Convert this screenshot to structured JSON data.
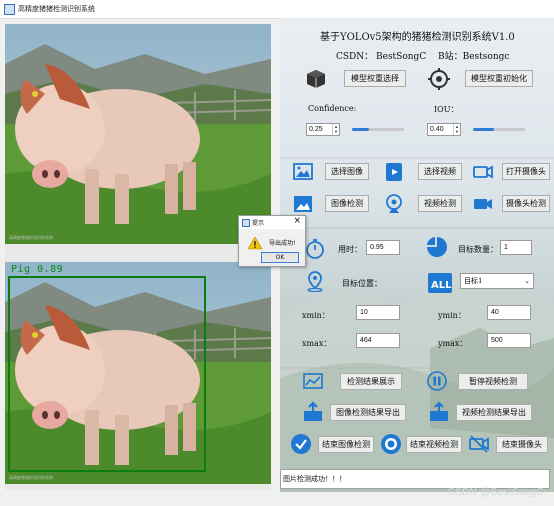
{
  "window": {
    "title": "高精度猪猪检测识别系统"
  },
  "header": {
    "title": "基于YOLOv5架构的猪猪检测识别系统V1.0",
    "csdn": "CSDN： BestSongC",
    "bili": "B站：Bestsongc"
  },
  "model": {
    "select_btn": "模型权重选择",
    "init_btn": "模型权重初始化"
  },
  "params": {
    "confidence_label": "Confidence:",
    "confidence_value": "0.25",
    "confidence_level": 0.25,
    "iou_label": "IOU：",
    "iou_value": "0.40",
    "iou_level": 0.4
  },
  "actions": {
    "select_image": "选择图像",
    "select_video": "选择视频",
    "open_camera": "打开摄像头",
    "image_detect": "图像检测",
    "video_detect": "视频检测",
    "camera_detect": "摄像头检测"
  },
  "stats": {
    "time_label": "用时：",
    "time_value": "0.95",
    "count_label": "目标数量：",
    "count_value": "1",
    "position_label": "目标位置：",
    "target_select": "目标1",
    "xmin_label": "xmin：",
    "xmin_value": "10",
    "ymin_label": "ymin：",
    "ymin_value": "40",
    "xmax_label": "xmax：",
    "xmax_value": "464",
    "ymax_label": "ymax：",
    "ymax_value": "500"
  },
  "bottom": {
    "show_result": "检测结果展示",
    "pause_video": "暂停视频检测",
    "export_image": "图像检测结果导出",
    "export_video": "视频检测结果导出",
    "end_image": "结束图像检测",
    "end_video": "结束视频检测",
    "end_camera": "结束摄像头"
  },
  "detection": {
    "label": "Pig  0.89"
  },
  "dialog": {
    "title": "提示",
    "message": "导出成功!",
    "ok": "OK"
  },
  "status_text": "图片检测成功！！！",
  "watermark": "CSDN @BestSongC",
  "colors": {
    "accent": "#2f7cd6",
    "box": "#0a7d12"
  }
}
